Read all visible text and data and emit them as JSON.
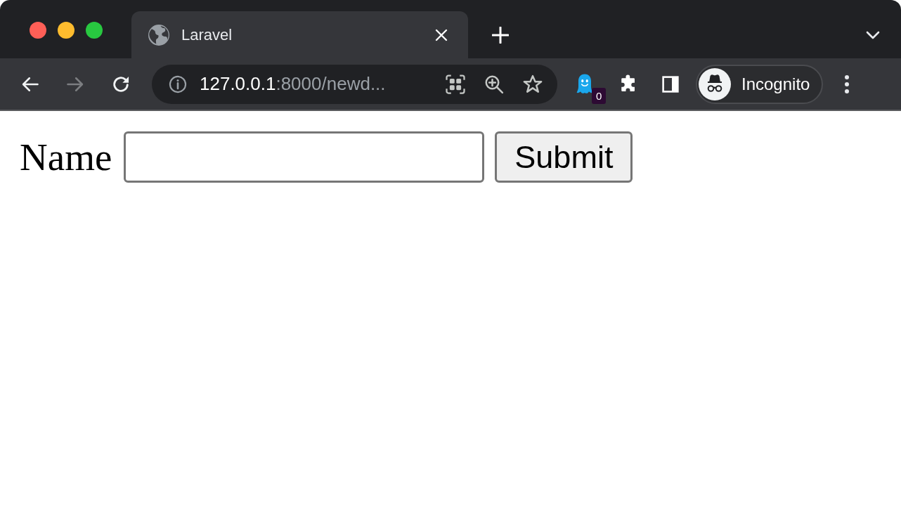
{
  "tabs": [
    {
      "title": "Laravel",
      "selected": true
    }
  ],
  "toolbar": {
    "nav_buttons": [
      {
        "kind": "back",
        "disabled": false
      },
      {
        "kind": "forward",
        "disabled": true
      },
      {
        "kind": "reload",
        "disabled": false
      }
    ],
    "address_bar": {
      "host": "127.0.0.1",
      "path": ":8000/newd..."
    },
    "extensions": [
      {
        "kind": "ghost",
        "badge": "0"
      },
      {
        "kind": "puzzle"
      },
      {
        "kind": "side_panel"
      }
    ],
    "profile": {
      "label": "Incognito"
    }
  },
  "form": {
    "fields": [
      {
        "label": "Name"
      }
    ],
    "submit": "Submit"
  }
}
